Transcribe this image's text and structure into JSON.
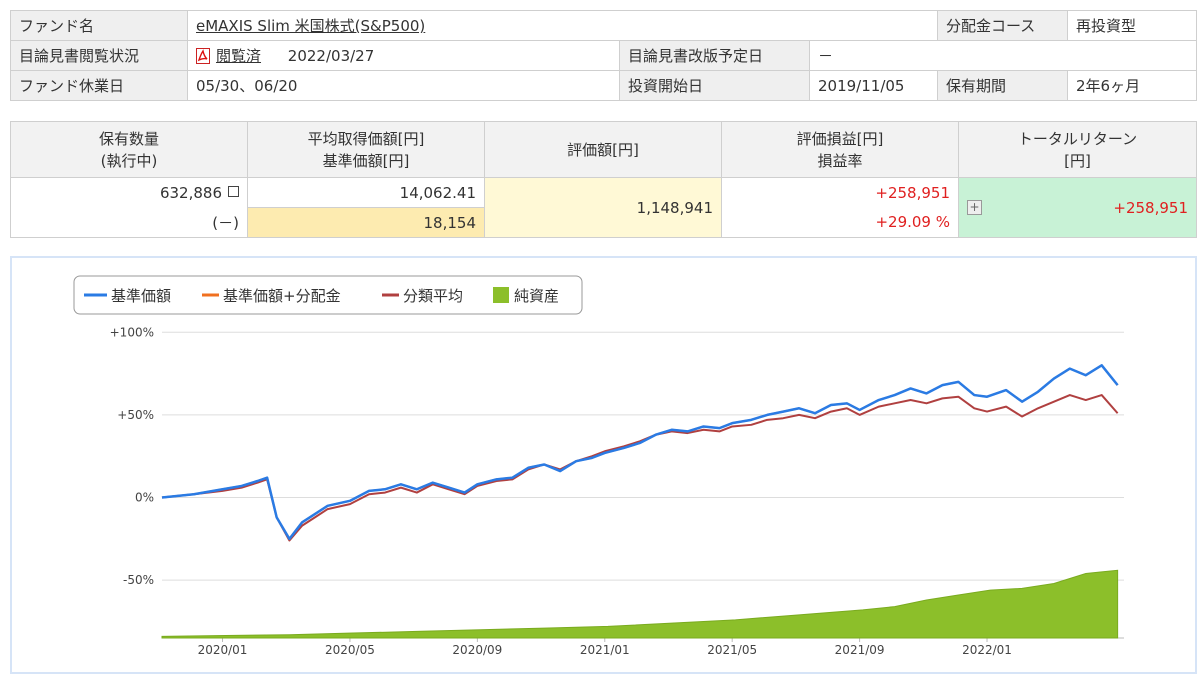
{
  "fund_info": {
    "fund_name_label": "ファンド名",
    "fund_name": "eMAXIS Slim 米国株式(S&P500)",
    "distribution_course_label": "分配金コース",
    "distribution_course": "再投資型",
    "prospectus_status_label": "目論見書閲覧状況",
    "prospectus_status_link": "閲覧済",
    "prospectus_status_date": "2022/03/27",
    "prospectus_revision_label": "目論見書改版予定日",
    "prospectus_revision": "－",
    "holidays_label": "ファンド休業日",
    "holidays": "05/30、06/20",
    "investment_start_label": "投資開始日",
    "investment_start": "2019/11/05",
    "holding_period_label": "保有期間",
    "holding_period": "2年6ヶ月"
  },
  "holdings": {
    "headers": {
      "quantity_line1": "保有数量",
      "quantity_line2": "(執行中)",
      "avg_price_line1": "平均取得価額[円]",
      "avg_price_line2": "基準価額[円]",
      "valuation": "評価額[円]",
      "pnl_line1": "評価損益[円]",
      "pnl_line2": "損益率",
      "total_return_line1": "トータルリターン",
      "total_return_line2": "[円]"
    },
    "quantity": "632,886",
    "quantity_pending": "(－)",
    "avg_price": "14,062.41",
    "nav": "18,154",
    "valuation": "1,148,941",
    "pnl": "+258,951",
    "pnl_rate": "+29.09 %",
    "total_return": "+258,951"
  },
  "chart_data": {
    "type": "line",
    "legend": [
      "基準価額",
      "基準価額+分配金",
      "分類平均",
      "純資産"
    ],
    "colors": {
      "nav": "#2a7be4",
      "nav_dist": "#f07020",
      "category_avg": "#b04040",
      "net_assets": "#8cbf2a"
    },
    "yticks": [
      "+100%",
      "+50%",
      "0%",
      "-50%"
    ],
    "ytick_values": [
      100,
      50,
      0,
      -50
    ],
    "ylim": [
      -85,
      105
    ],
    "xticks": [
      "2020/01",
      "2020/05",
      "2020/09",
      "2021/01",
      "2021/05",
      "2021/09",
      "2022/01"
    ],
    "xtick_values": [
      1.9,
      5.9,
      9.9,
      13.9,
      17.9,
      21.9,
      25.9
    ],
    "xlim": [
      0,
      30.2
    ],
    "series": [
      {
        "name": "基準価額",
        "key": "nav",
        "x": [
          0,
          1,
          1.9,
          2.5,
          3,
          3.3,
          3.6,
          4,
          4.4,
          4.8,
          5.2,
          5.9,
          6.5,
          7,
          7.5,
          8,
          8.5,
          9,
          9.5,
          9.9,
          10.5,
          11,
          11.5,
          12,
          12.5,
          13,
          13.5,
          13.9,
          14.5,
          15,
          15.5,
          16,
          16.5,
          17,
          17.5,
          17.9,
          18.5,
          19,
          19.5,
          20,
          20.5,
          21,
          21.5,
          21.9,
          22.5,
          23,
          23.5,
          24,
          24.5,
          25,
          25.5,
          25.9,
          26.5,
          27,
          27.5,
          28,
          28.5,
          29,
          29.5,
          30
        ],
        "y": [
          0,
          2,
          5,
          7,
          10,
          12,
          -12,
          -25,
          -15,
          -10,
          -5,
          -2,
          4,
          5,
          8,
          5,
          9,
          6,
          3,
          8,
          11,
          12,
          18,
          20,
          16,
          22,
          24,
          27,
          30,
          33,
          38,
          41,
          40,
          43,
          42,
          45,
          47,
          50,
          52,
          54,
          51,
          56,
          57,
          53,
          59,
          62,
          66,
          63,
          68,
          70,
          62,
          61,
          65,
          58,
          64,
          72,
          78,
          74,
          80,
          68
        ]
      },
      {
        "name": "基準価額+分配金",
        "key": "nav_dist",
        "x": [
          0,
          1,
          1.9,
          2.5,
          3,
          3.3,
          3.6,
          4,
          4.4,
          4.8,
          5.2,
          5.9,
          6.5,
          7,
          7.5,
          8,
          8.5,
          9,
          9.5,
          9.9,
          10.5,
          11,
          11.5,
          12,
          12.5,
          13,
          13.5,
          13.9,
          14.5,
          15,
          15.5,
          16,
          16.5,
          17,
          17.5,
          17.9,
          18.5,
          19,
          19.5,
          20,
          20.5,
          21,
          21.5,
          21.9,
          22.5,
          23,
          23.5,
          24,
          24.5,
          25,
          25.5,
          25.9,
          26.5,
          27,
          27.5,
          28,
          28.5,
          29,
          29.5,
          30
        ],
        "y": [
          0,
          2,
          5,
          7,
          10,
          12,
          -12,
          -25,
          -15,
          -10,
          -5,
          -2,
          4,
          5,
          8,
          5,
          9,
          6,
          3,
          8,
          11,
          12,
          18,
          20,
          16,
          22,
          24,
          27,
          30,
          33,
          38,
          41,
          40,
          43,
          42,
          45,
          47,
          50,
          52,
          54,
          51,
          56,
          57,
          53,
          59,
          62,
          66,
          63,
          68,
          70,
          62,
          61,
          65,
          58,
          64,
          72,
          78,
          74,
          80,
          68
        ]
      },
      {
        "name": "分類平均",
        "key": "category_avg",
        "x": [
          0,
          1,
          1.9,
          2.5,
          3,
          3.3,
          3.6,
          4,
          4.4,
          4.8,
          5.2,
          5.9,
          6.5,
          7,
          7.5,
          8,
          8.5,
          9,
          9.5,
          9.9,
          10.5,
          11,
          11.5,
          12,
          12.5,
          13,
          13.5,
          13.9,
          14.5,
          15,
          15.5,
          16,
          16.5,
          17,
          17.5,
          17.9,
          18.5,
          19,
          19.5,
          20,
          20.5,
          21,
          21.5,
          21.9,
          22.5,
          23,
          23.5,
          24,
          24.5,
          25,
          25.5,
          25.9,
          26.5,
          27,
          27.5,
          28,
          28.5,
          29,
          29.5,
          30
        ],
        "y": [
          0,
          2,
          4,
          6,
          9,
          11,
          -12,
          -26,
          -17,
          -12,
          -7,
          -4,
          2,
          3,
          6,
          3,
          8,
          5,
          2,
          7,
          10,
          11,
          17,
          20,
          17,
          22,
          25,
          28,
          31,
          34,
          38,
          40,
          39,
          41,
          40,
          43,
          44,
          47,
          48,
          50,
          48,
          52,
          54,
          50,
          55,
          57,
          59,
          57,
          60,
          61,
          54,
          52,
          55,
          49,
          54,
          58,
          62,
          59,
          62,
          51
        ]
      },
      {
        "name": "純資産",
        "key": "net_assets",
        "x": [
          0,
          2,
          4,
          6,
          8,
          10,
          12,
          14,
          16,
          18,
          20,
          22,
          23,
          24,
          25,
          26,
          27,
          28,
          29,
          29.5,
          30
        ],
        "y": [
          -84,
          -83.5,
          -83,
          -82,
          -81,
          -80,
          -79,
          -78,
          -76,
          -74,
          -71,
          -68,
          -66,
          -62,
          -59,
          -56,
          -55,
          -52,
          -46,
          -45,
          -44
        ]
      }
    ]
  }
}
